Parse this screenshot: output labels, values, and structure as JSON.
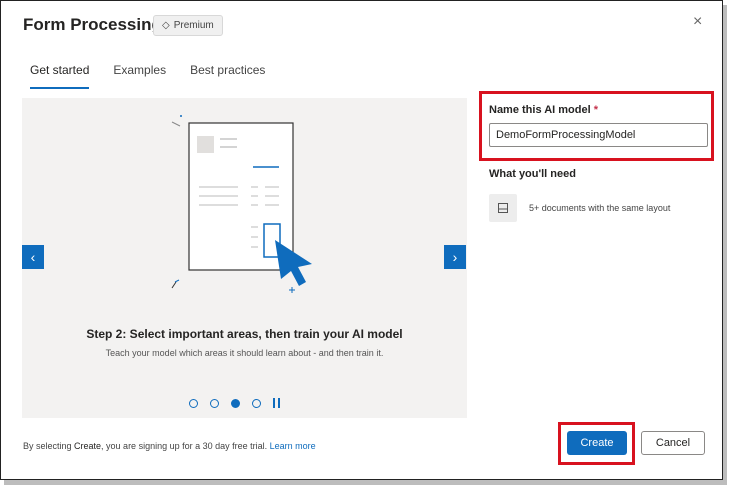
{
  "dialog": {
    "title": "Form Processing",
    "badge": "Premium",
    "close": "×"
  },
  "tabs": [
    {
      "label": "Get started",
      "active": true
    },
    {
      "label": "Examples",
      "active": false
    },
    {
      "label": "Best practices",
      "active": false
    }
  ],
  "carousel": {
    "step_title": "Step 2: Select important areas, then train your AI model",
    "step_desc": "Teach your model which areas it should learn about - and then train it.",
    "prev": "‹",
    "next": "›",
    "dots_total": 4,
    "active_dot": 3
  },
  "form": {
    "name_label": "Name this AI model",
    "required_mark": "*",
    "name_value": "DemoFormProcessingModel",
    "need_label": "What you'll need",
    "need_item": "5+ documents with the same layout"
  },
  "footer": {
    "text_prefix": "By selecting ",
    "text_bold": "Create",
    "text_suffix": ", you are signing up for a 30 day free trial. ",
    "link": "Learn more"
  },
  "buttons": {
    "create": "Create",
    "cancel": "Cancel"
  },
  "colors": {
    "accent": "#0f6cbd",
    "highlight": "#d8121f"
  }
}
